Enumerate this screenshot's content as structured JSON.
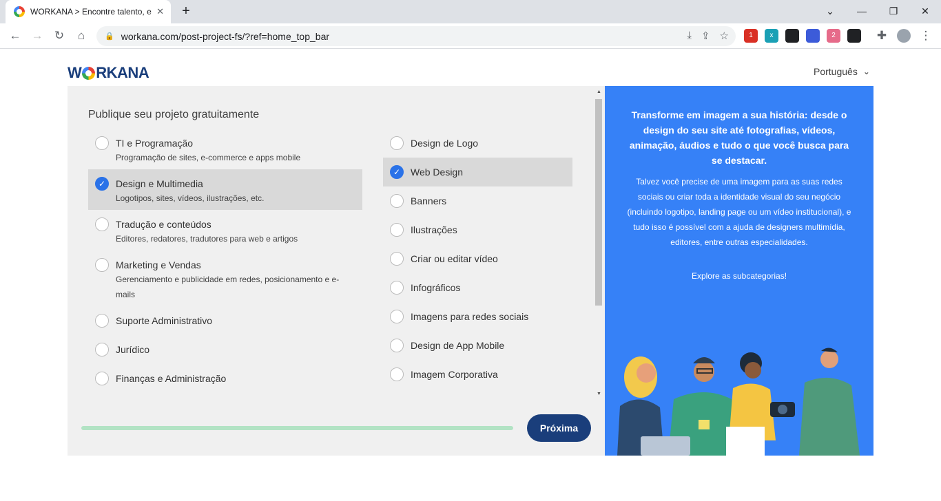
{
  "browser": {
    "tab_title": "WORKANA > Encontre talento, e",
    "tab_close": "✕",
    "new_tab": "+",
    "url": "workana.com/post-project-fs/?ref=home_top_bar",
    "window": {
      "minimize": "—",
      "restore": "❐",
      "close": "✕"
    },
    "nav": {
      "back": "←",
      "forward": "→",
      "reload": "↻",
      "home": "⌂"
    },
    "extensions": [
      {
        "name": "ext-red",
        "color": "#d93025",
        "badge": "1"
      },
      {
        "name": "ext-teal",
        "color": "#1aa0b5",
        "badge": "x"
      },
      {
        "name": "ext-dash",
        "color": "#202124",
        "badge": ""
      },
      {
        "name": "ext-face",
        "color": "#3c5bd9",
        "badge": ""
      },
      {
        "name": "ext-pink",
        "color": "#e66b8a",
        "badge": "2"
      },
      {
        "name": "ext-dark",
        "color": "#202124",
        "badge": ""
      }
    ]
  },
  "header": {
    "logo": "WORKANA",
    "language": "Português"
  },
  "form": {
    "title": "Publique seu projeto gratuitamente",
    "categories": [
      {
        "label": "TI e Programação",
        "desc": "Programação de sites, e-commerce e apps mobile",
        "checked": false
      },
      {
        "label": "Design e Multimedia",
        "desc": "Logotipos, sites, vídeos, ilustrações, etc.",
        "checked": true
      },
      {
        "label": "Tradução e conteúdos",
        "desc": "Editores, redatores, tradutores para web e artigos",
        "checked": false
      },
      {
        "label": "Marketing e Vendas",
        "desc": "Gerenciamento e publicidade em redes, posicionamento e e-mails",
        "checked": false
      },
      {
        "label": "Suporte Administrativo",
        "desc": "",
        "checked": false
      },
      {
        "label": "Jurídico",
        "desc": "",
        "checked": false
      },
      {
        "label": "Finanças e Administração",
        "desc": "",
        "checked": false
      }
    ],
    "subcategories": [
      {
        "label": "Design de Logo",
        "checked": false
      },
      {
        "label": "Web Design",
        "checked": true
      },
      {
        "label": "Banners",
        "checked": false
      },
      {
        "label": "Ilustrações",
        "checked": false
      },
      {
        "label": "Criar ou editar vídeo",
        "checked": false
      },
      {
        "label": "Infográficos",
        "checked": false
      },
      {
        "label": "Imagens para redes sociais",
        "checked": false
      },
      {
        "label": "Design de App Mobile",
        "checked": false
      },
      {
        "label": "Imagem Corporativa",
        "checked": false
      }
    ],
    "next_button": "Próxima",
    "progress_fraction": 1.0
  },
  "side": {
    "heading": "Transforme em imagem a sua história: desde o design do seu site até fotografias, vídeos, animação, áudios e tudo o que você busca para se destacar.",
    "body": "Talvez você precise de uma imagem para as suas redes sociais ou criar toda a identidade visual do seu negócio (incluindo logotipo, landing page ou um vídeo institucional), e tudo isso é possível com a ajuda de designers multimídia, editores, entre outras especialidades.",
    "explore": "Explore as subcategorias!"
  },
  "colors": {
    "brand_blue": "#1a3e7b",
    "side_blue": "#3681f7",
    "check_blue": "#2a72e8",
    "progress_green": "#b2e3c4"
  }
}
